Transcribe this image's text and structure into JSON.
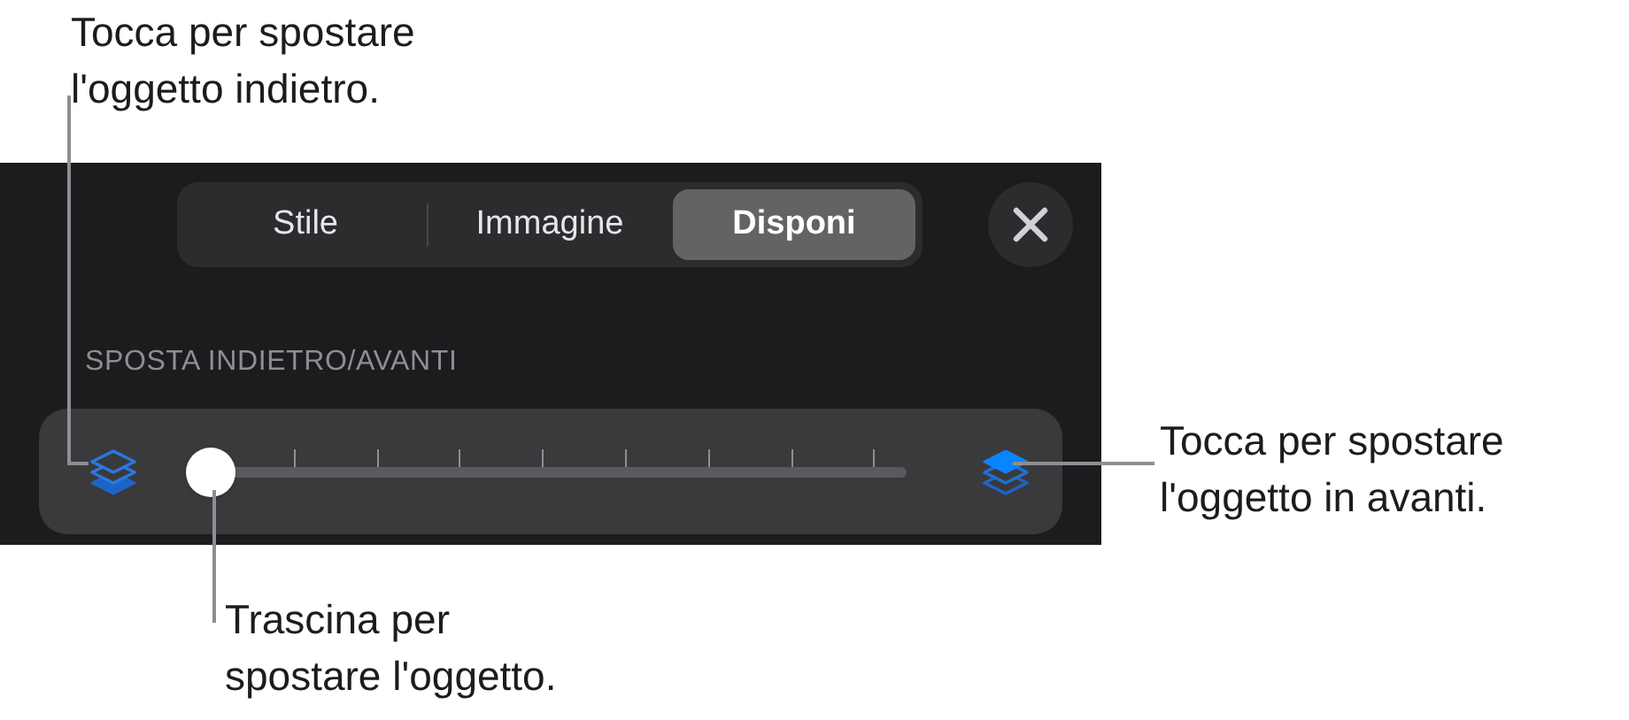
{
  "callouts": {
    "back": "Tocca per spostare\nl'oggetto indietro.",
    "forward": "Tocca per spostare\nl'oggetto in avanti.",
    "drag": "Trascina per\nspostare l'oggetto."
  },
  "tabs": [
    {
      "label": "Stile",
      "selected": false
    },
    {
      "label": "Immagine",
      "selected": false
    },
    {
      "label": "Disponi",
      "selected": true
    }
  ],
  "section_label": "SPOSTA INDIETRO/AVANTI",
  "slider": {
    "level": 0
  }
}
